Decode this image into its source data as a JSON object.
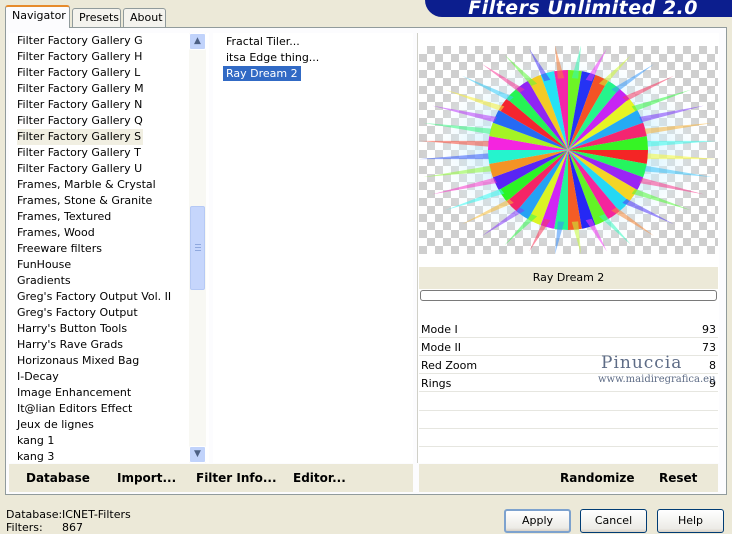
{
  "tabs": [
    {
      "label": "Navigator",
      "active": true
    },
    {
      "label": "Presets",
      "active": false
    },
    {
      "label": "About",
      "active": false
    }
  ],
  "banner_title": "Filters Unlimited 2.0",
  "categories": [
    "Filter Factory Gallery G",
    "Filter Factory Gallery H",
    "Filter Factory Gallery L",
    "Filter Factory Gallery M",
    "Filter Factory Gallery N",
    "Filter Factory Gallery Q",
    "Filter Factory Gallery S",
    "Filter Factory Gallery T",
    "Filter Factory Gallery U",
    "Frames, Marble & Crystal",
    "Frames, Stone & Granite",
    "Frames, Textured",
    "Frames, Wood",
    "Freeware filters",
    "FunHouse",
    "Gradients",
    "Greg's Factory Output Vol. II",
    "Greg's Factory Output",
    "Harry's Button Tools",
    "Harry's Rave Grads",
    "Horizonaus Mixed Bag",
    "I-Decay",
    "Image Enhancement",
    "It@lian Editors Effect",
    "Jeux de lignes",
    "kang 1",
    "kang 3"
  ],
  "selected_category": "Filter Factory Gallery S",
  "filters": [
    "Fractal Tiler...",
    "itsa Edge thing...",
    "Ray Dream 2"
  ],
  "selected_filter": "Ray Dream 2",
  "left_buttons": {
    "database": "Database",
    "import": "Import...",
    "filter_info": "Filter Info...",
    "editor": "Editor..."
  },
  "preview_filter_name": "Ray Dream 2",
  "params": [
    {
      "label": "Mode I",
      "value": "93"
    },
    {
      "label": "Mode II",
      "value": "73"
    },
    {
      "label": "Red Zoom",
      "value": "8"
    },
    {
      "label": "Rings",
      "value": "9"
    }
  ],
  "watermark": {
    "name": "Pinuccia",
    "url": "www.maidiregrafica.eu"
  },
  "right_buttons": {
    "randomize": "Randomize",
    "reset": "Reset"
  },
  "footer": {
    "database_label": "Database:",
    "database_value": "ICNET-Filters",
    "filters_label": "Filters:",
    "filters_value": "867"
  },
  "dialog_buttons": {
    "apply": "Apply",
    "cancel": "Cancel",
    "help": "Help"
  },
  "scroll_arrows": {
    "up": "▲",
    "down": "▼"
  }
}
